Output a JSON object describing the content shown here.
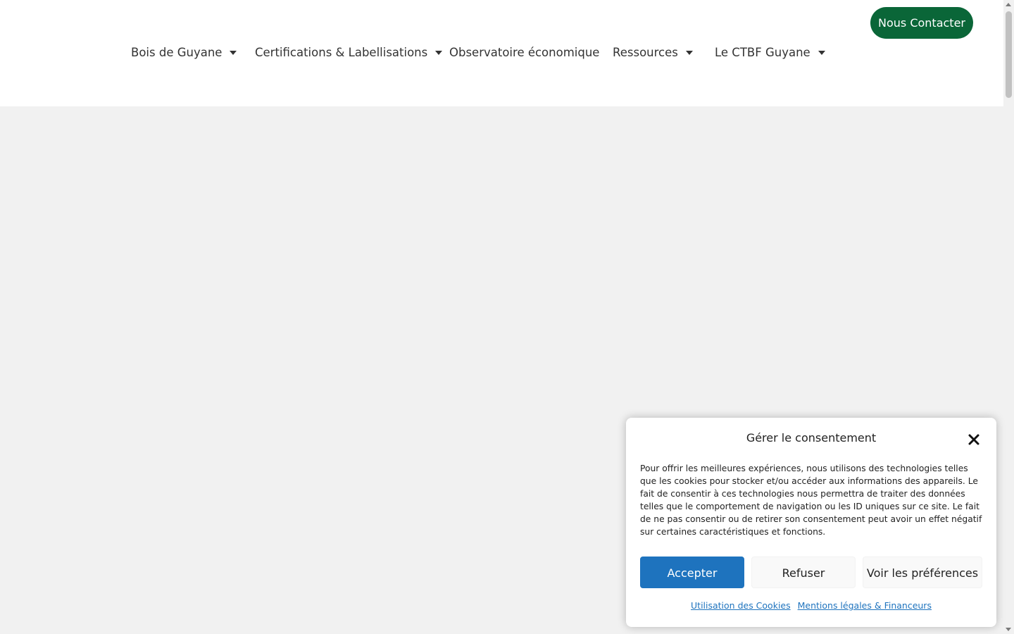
{
  "header": {
    "cta_label": "Nous Contacter",
    "nav": [
      {
        "label": "Bois de Guyane",
        "has_dropdown": true
      },
      {
        "label": "Certifications & Labellisations",
        "has_dropdown": true
      },
      {
        "label": "Observatoire économique",
        "has_dropdown": false
      },
      {
        "label": "Ressources",
        "has_dropdown": true
      },
      {
        "label": "Le CTBF Guyane",
        "has_dropdown": true
      }
    ]
  },
  "consent": {
    "title": "Gérer le consentement",
    "text": "Pour offrir les meilleures expériences, nous utilisons des technologies telles que les cookies pour stocker et/ou accéder aux informations des appareils. Le fait de consentir à ces technologies nous permettra de traiter des données telles que le comportement de navigation ou les ID uniques sur ce site. Le fait de ne pas consentir ou de retirer son consentement peut avoir un effet négatif sur certaines caractéristiques et fonctions.",
    "accept_label": "Accepter",
    "refuse_label": "Refuser",
    "preferences_label": "Voir les préférences",
    "links": [
      "Utilisation des Cookies",
      "Mentions légales & Financeurs"
    ]
  },
  "colors": {
    "brand_green": "#0a6638",
    "accept_blue": "#1e73be",
    "content_bg": "#f1f1f1"
  }
}
